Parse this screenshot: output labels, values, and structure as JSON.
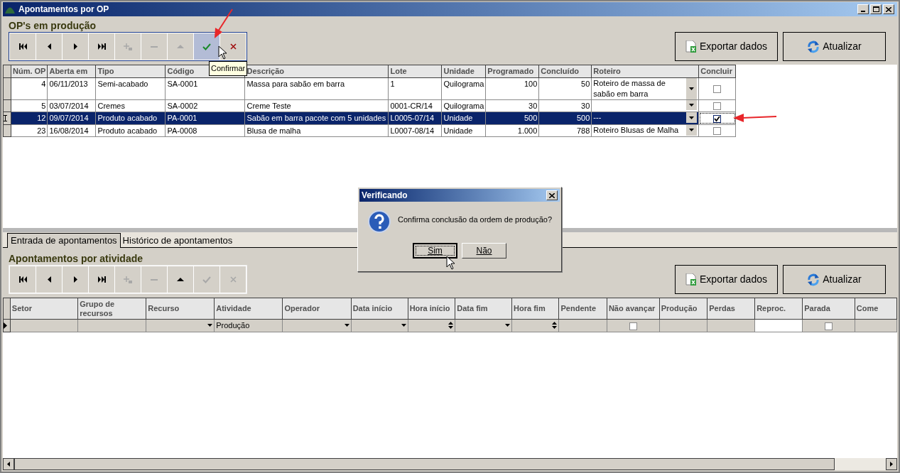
{
  "window": {
    "title": "Apontamentos por OP"
  },
  "top_section": {
    "heading": "OP's em produção",
    "navigator": [
      {
        "kind": "first",
        "disabled": false,
        "hovered": false,
        "callout": false
      },
      {
        "kind": "prior",
        "disabled": false,
        "hovered": false,
        "callout": false
      },
      {
        "kind": "next",
        "disabled": false,
        "hovered": false,
        "callout": false
      },
      {
        "kind": "last",
        "disabled": false,
        "hovered": false,
        "callout": false
      },
      {
        "kind": "insert",
        "disabled": true,
        "hovered": false,
        "callout": false
      },
      {
        "kind": "delete",
        "disabled": true,
        "hovered": false,
        "callout": false
      },
      {
        "kind": "edit",
        "disabled": true,
        "hovered": false,
        "callout": false
      },
      {
        "kind": "post",
        "disabled": false,
        "hovered": true,
        "callout": true
      },
      {
        "kind": "cancel",
        "disabled": false,
        "hovered": false,
        "callout": false
      }
    ],
    "tooltip": "Confirmar",
    "buttons": [
      {
        "kind": "export",
        "label": "Exportar dados"
      },
      {
        "kind": "refresh",
        "label": "Atualizar"
      }
    ],
    "table": {
      "columns": [
        {
          "label": "Núm. OP",
          "kind": "number"
        },
        {
          "label": "Aberta em",
          "kind": "text"
        },
        {
          "label": "Tipo",
          "kind": "text"
        },
        {
          "label": "Código",
          "kind": "text"
        },
        {
          "label": "Descrição",
          "kind": "text"
        },
        {
          "label": "Lote",
          "kind": "text"
        },
        {
          "label": "Unidade",
          "kind": "text"
        },
        {
          "label": "Programado",
          "kind": "number"
        },
        {
          "label": "Concluído",
          "kind": "number"
        },
        {
          "label": "Roteiro",
          "kind": "dropdown"
        },
        {
          "label": "Concluir",
          "kind": "checkbox"
        }
      ],
      "rows": [
        {
          "selected": false,
          "callout": false,
          "checked": false,
          "cells": [
            "4",
            "06/11/2013",
            "Semi-acabado",
            "SA-0001",
            "Massa para sabão em barra",
            "1",
            "Quilograma",
            "100",
            "50",
            "Roteiro de massa de sabão em barra"
          ]
        },
        {
          "selected": false,
          "callout": false,
          "checked": false,
          "cells": [
            "5",
            "03/07/2014",
            "Cremes",
            "SA-0002",
            "Creme Teste",
            "0001-CR/14",
            "Quilograma",
            "30",
            "30",
            null
          ]
        },
        {
          "selected": true,
          "callout": true,
          "checked": true,
          "cells": [
            "12",
            "09/07/2014",
            "Produto acabado",
            "PA-0001",
            "Sabão em barra pacote com 5 unidades",
            "L0005-07/14",
            "Unidade",
            "500",
            "500",
            "---"
          ]
        },
        {
          "selected": false,
          "callout": false,
          "checked": false,
          "cells": [
            "23",
            "16/08/2014",
            "Produto acabado",
            "PA-0008",
            "Blusa de malha",
            "L0007-08/14",
            "Unidade",
            "1.000",
            "788",
            "Roteiro Blusas de Malha"
          ]
        }
      ]
    }
  },
  "tabs": [
    {
      "label": "Entrada de apontamentos",
      "selected": true
    },
    {
      "label": "Histórico de apontamentos",
      "selected": false
    }
  ],
  "bottom_section": {
    "heading": "Apontamentos por atividade",
    "navigator": [
      {
        "kind": "first",
        "disabled": false,
        "hovered": false
      },
      {
        "kind": "prior",
        "disabled": false,
        "hovered": false
      },
      {
        "kind": "next",
        "disabled": false,
        "hovered": false
      },
      {
        "kind": "last",
        "disabled": false,
        "hovered": false
      },
      {
        "kind": "insert",
        "disabled": true,
        "hovered": false
      },
      {
        "kind": "delete",
        "disabled": true,
        "hovered": false
      },
      {
        "kind": "edit",
        "disabled": false,
        "hovered": false
      },
      {
        "kind": "post",
        "disabled": true,
        "hovered": false
      },
      {
        "kind": "cancel",
        "disabled": true,
        "hovered": false
      }
    ],
    "buttons": [
      {
        "kind": "export",
        "label": "Exportar dados"
      },
      {
        "kind": "refresh",
        "label": "Atualizar"
      }
    ],
    "table": {
      "columns": [
        "Setor",
        "Grupo de recursos",
        "Recurso",
        "Atividade",
        "Operador",
        "Data início",
        "Hora início",
        "Data fim",
        "Hora fim",
        "Pendente",
        "Não avançar",
        "Produção",
        "Perdas",
        "Reproc.",
        "Parada",
        "Come"
      ],
      "row": [
        {
          "kind": "text"
        },
        {
          "kind": "text"
        },
        {
          "kind": "dropdown"
        },
        {
          "kind": "text",
          "value": "Produção"
        },
        {
          "kind": "dropdown"
        },
        {
          "kind": "dropdown"
        },
        {
          "kind": "spin"
        },
        {
          "kind": "dropdown"
        },
        {
          "kind": "spin"
        },
        {
          "kind": "text"
        },
        {
          "kind": "checkbox",
          "checked": false
        },
        {
          "kind": "text"
        },
        {
          "kind": "text"
        },
        {
          "kind": "input"
        },
        {
          "kind": "checkbox",
          "checked": false
        },
        {
          "kind": "text"
        }
      ]
    }
  },
  "dialog": {
    "title": "Verificando",
    "message": "Confirma conclusão da ordem de produção?",
    "buttons": [
      {
        "label": "Sim",
        "focused": true
      },
      {
        "label": "Não",
        "focused": false
      }
    ]
  }
}
